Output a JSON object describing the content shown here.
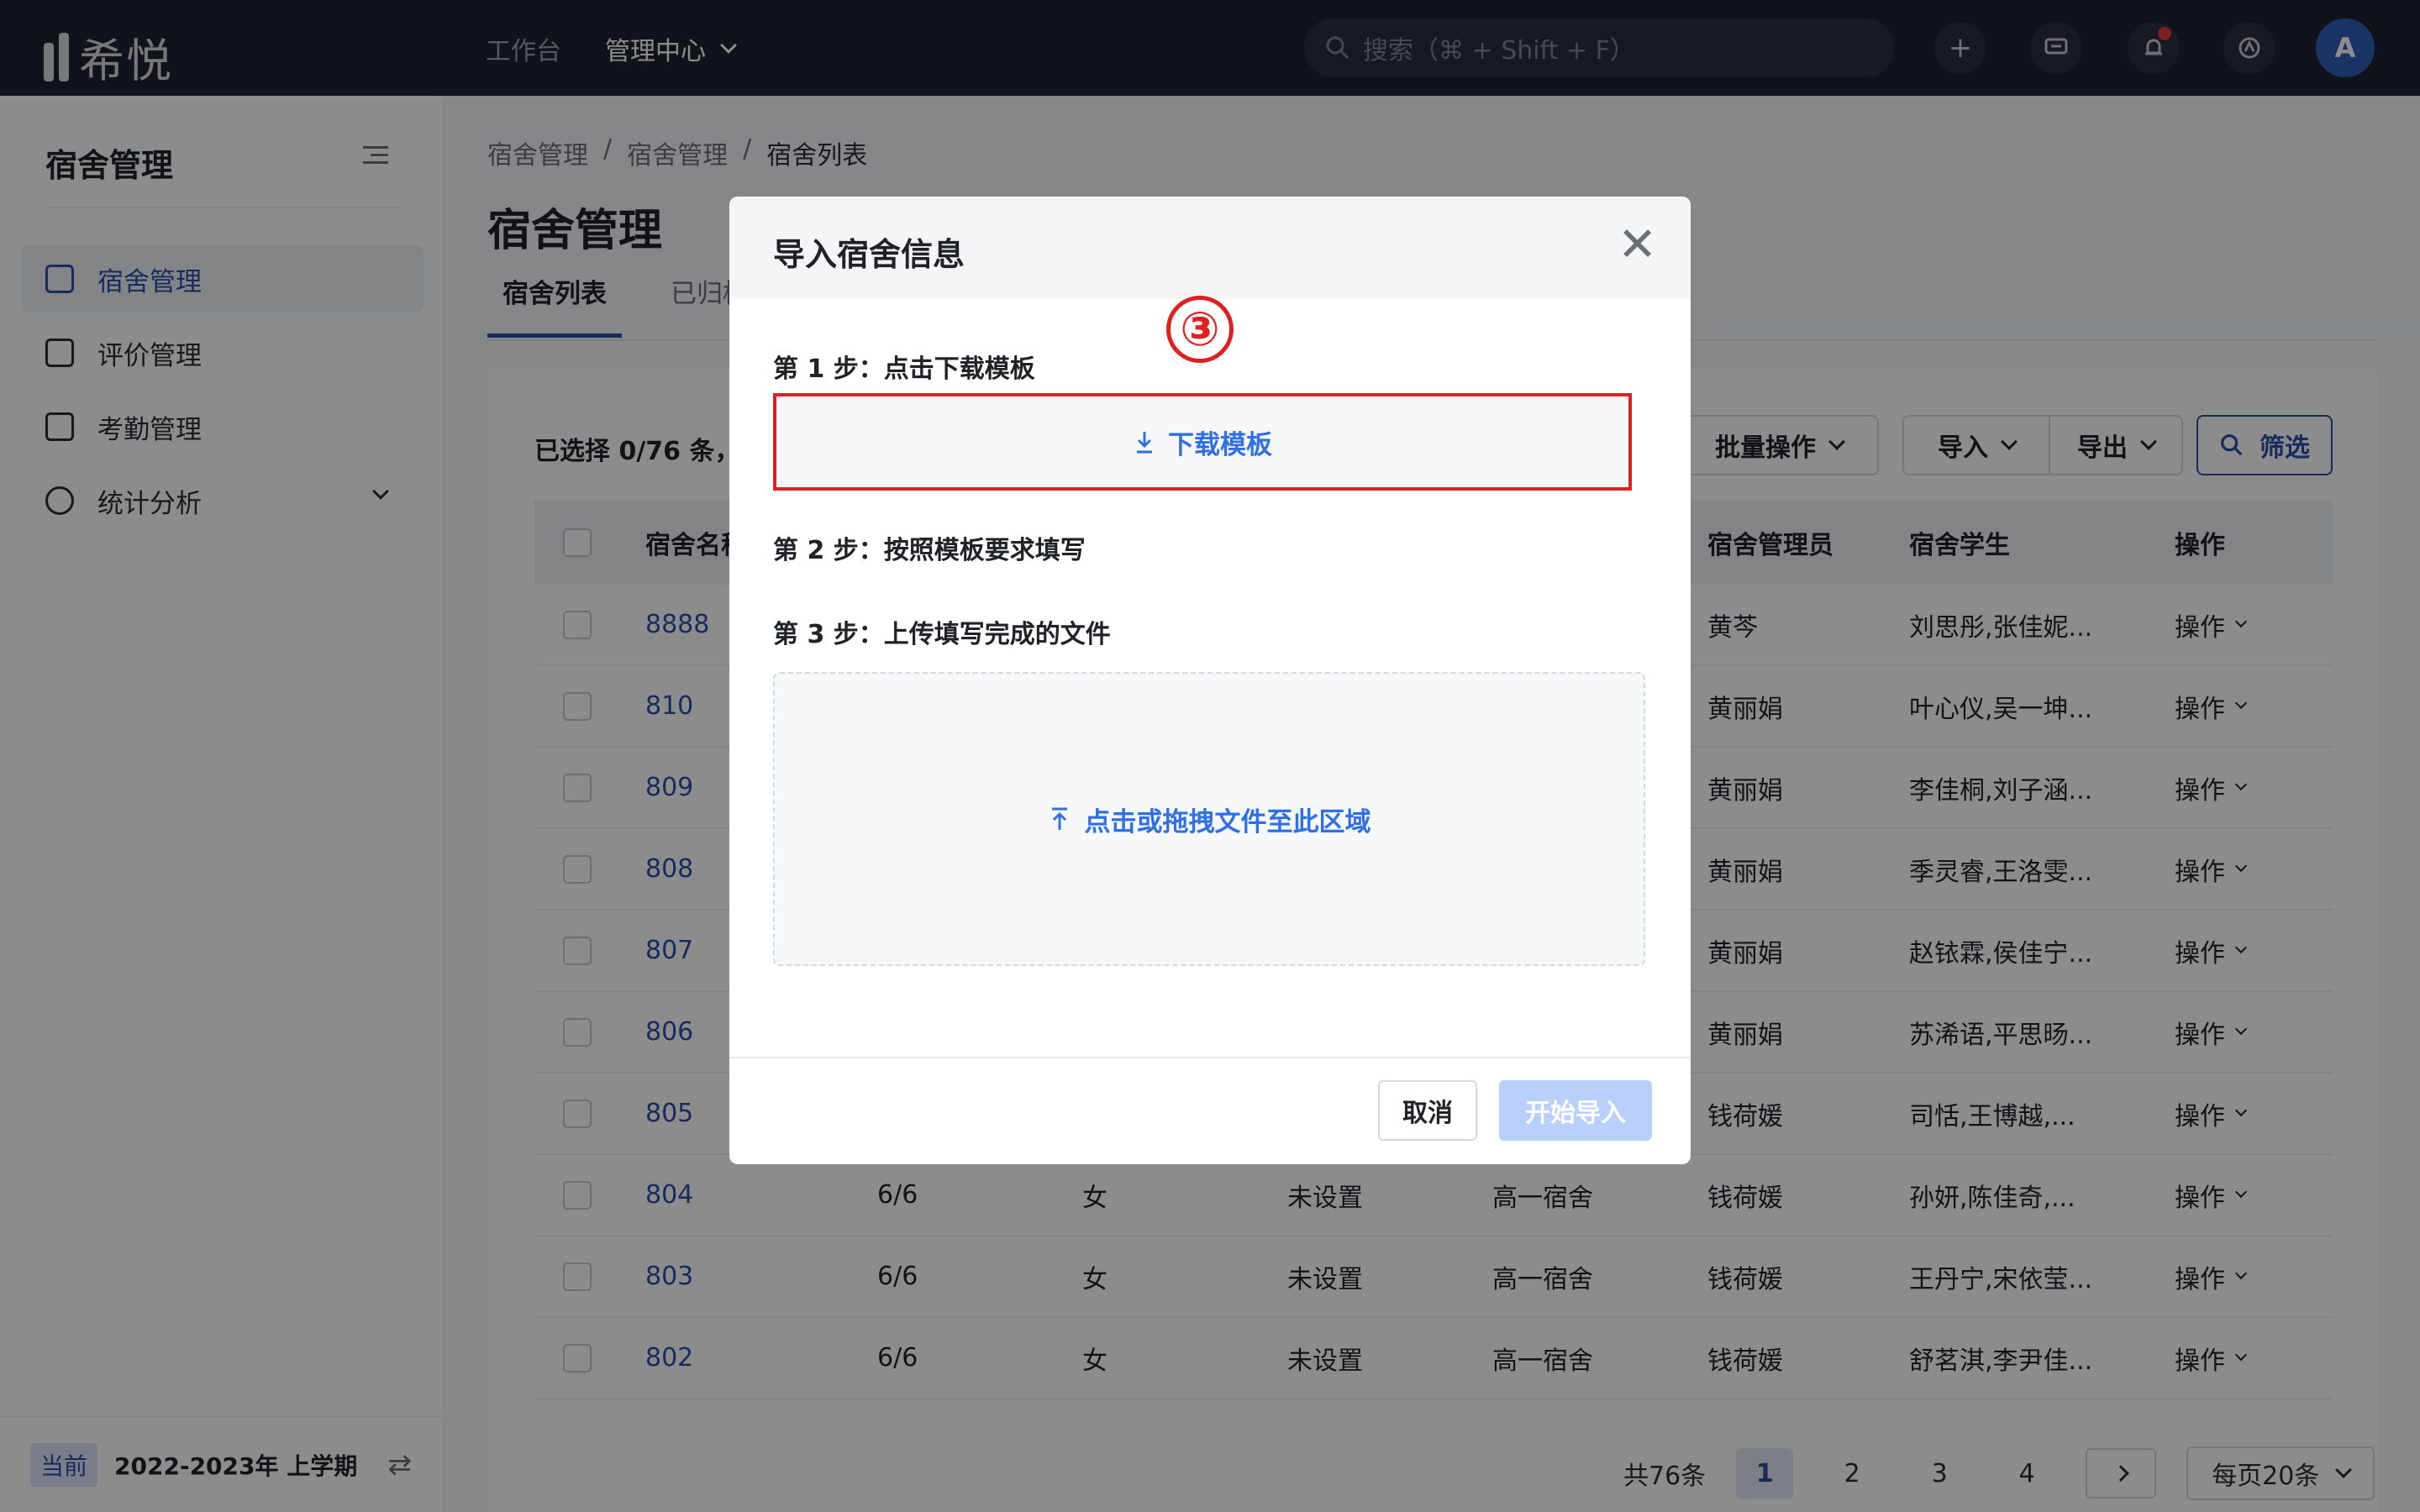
{
  "topbar": {
    "logo_text": "希悦",
    "nav": [
      {
        "label": "工作台"
      },
      {
        "label": "管理中心"
      }
    ],
    "search_placeholder": "搜索（⌘ + Shift + F）",
    "avatar_letter": "A"
  },
  "sidebar": {
    "title": "宿舍管理",
    "items": [
      {
        "label": "宿舍管理",
        "icon": "bed-icon"
      },
      {
        "label": "评价管理",
        "icon": "document-edit-icon"
      },
      {
        "label": "考勤管理",
        "icon": "calendar-check-icon"
      },
      {
        "label": "统计分析",
        "icon": "pie-chart-icon"
      }
    ],
    "term_tag": "当前",
    "term_label": "2022-2023年 上学期"
  },
  "main": {
    "breadcrumb": [
      "宿舍管理",
      "宿舍管理",
      "宿舍列表"
    ],
    "breadcrumb_sep": "/",
    "title": "宿舍管理",
    "tabs": [
      {
        "label": "宿舍列表"
      },
      {
        "label": "已归档"
      }
    ],
    "selection_info": "已选择 0/76 条，",
    "toolbar": {
      "batch": "批量操作",
      "import": "导入",
      "export": "导出",
      "filter": "筛选"
    },
    "table": {
      "headers": [
        "宿舍名称",
        "宿舍管理员",
        "宿舍学生",
        "操作"
      ],
      "rows": [
        {
          "name": "8888",
          "beds": "",
          "gender": "",
          "type": "",
          "group": "",
          "manager": "黄芩",
          "students": "刘思彤,张佳妮...",
          "action": "操作"
        },
        {
          "name": "810",
          "beds": "",
          "gender": "",
          "type": "",
          "group": "",
          "manager": "黄丽娟",
          "students": "叶心仪,吴一坤...",
          "action": "操作"
        },
        {
          "name": "809",
          "beds": "",
          "gender": "",
          "type": "",
          "group": "",
          "manager": "黄丽娟",
          "students": "李佳桐,刘子涵...",
          "action": "操作"
        },
        {
          "name": "808",
          "beds": "",
          "gender": "",
          "type": "",
          "group": "",
          "manager": "黄丽娟",
          "students": "季灵睿,王洛雯...",
          "action": "操作"
        },
        {
          "name": "807",
          "beds": "",
          "gender": "",
          "type": "",
          "group": "",
          "manager": "黄丽娟",
          "students": "赵铱霖,侯佳宁...",
          "action": "操作"
        },
        {
          "name": "806",
          "beds": "",
          "gender": "",
          "type": "",
          "group": "",
          "manager": "黄丽娟",
          "students": "苏浠语,平思旸...",
          "action": "操作"
        },
        {
          "name": "805",
          "beds": "",
          "gender": "",
          "type": "",
          "group": "",
          "manager": "钱荷媛",
          "students": "司恬,王博越,...",
          "action": "操作"
        },
        {
          "name": "804",
          "beds": "6/6",
          "gender": "女",
          "type": "未设置",
          "group": "高一宿舍",
          "manager": "钱荷媛",
          "students": "孙妍,陈佳奇,...",
          "action": "操作"
        },
        {
          "name": "803",
          "beds": "6/6",
          "gender": "女",
          "type": "未设置",
          "group": "高一宿舍",
          "manager": "钱荷媛",
          "students": "王丹宁,宋依莹...",
          "action": "操作"
        },
        {
          "name": "802",
          "beds": "6/6",
          "gender": "女",
          "type": "未设置",
          "group": "高一宿舍",
          "manager": "钱荷媛",
          "students": "舒茗淇,李尹佳...",
          "action": "操作"
        }
      ]
    },
    "pagination": {
      "total": "共76条",
      "pages": [
        "1",
        "2",
        "3",
        "4"
      ],
      "page_size": "每页20条"
    }
  },
  "modal": {
    "title": "导入宿舍信息",
    "annotation": "③",
    "step1": "第 1 步：点击下载模板",
    "download_label": "下载模板",
    "step2": "第 2 步：按照模板要求填写",
    "step3": "第 3 步：上传填写完成的文件",
    "upload_label": "点击或拖拽文件至此区域",
    "cancel": "取消",
    "start": "开始导入"
  }
}
